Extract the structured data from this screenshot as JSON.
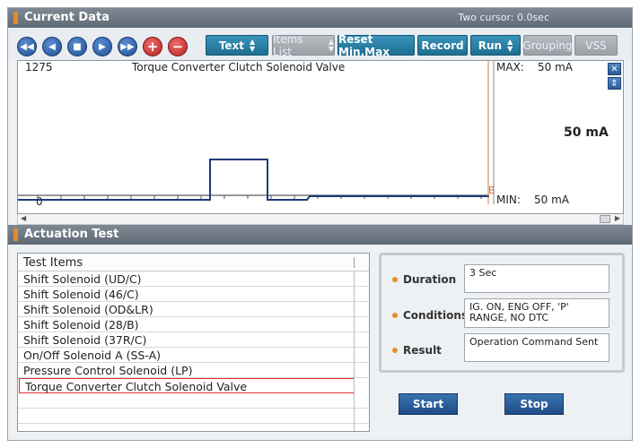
{
  "current_data": {
    "title": "Current Data",
    "cursor_text": "Two cursor: 0.0sec"
  },
  "toolbar": {
    "nav_icons": [
      "rewind-icon",
      "previous-icon",
      "stop-icon",
      "play-icon",
      "fast-forward-icon",
      "zoom-in-icon",
      "zoom-out-icon"
    ],
    "text_label": "Text",
    "items_list_label": "Items List",
    "reset_label": "Reset Min.Max",
    "record_label": "Record",
    "run_label": "Run",
    "grouping_label": "Grouping",
    "vss_label": "VSS"
  },
  "graph": {
    "id_label": "1275",
    "signal_name": "Torque Converter Clutch Solenoid Valve",
    "y_top": "",
    "y_bottom": "0",
    "max_label": "MAX:",
    "max_value": "50 mA",
    "min_label": "MIN:",
    "min_value": "50 mA",
    "current_value": "50 mA",
    "cursor_b": "B"
  },
  "actuation": {
    "title": "Actuation Test",
    "list_header": "Test Items",
    "items": [
      "Shift Solenoid (UD/C)",
      "Shift Solenoid (46/C)",
      "Shift Solenoid (OD&LR)",
      "Shift Solenoid (28/B)",
      "Shift Solenoid (37R/C)",
      "On/Off Solenoid A (SS-A)",
      "Pressure Control Solenoid (LP)",
      "Torque Converter Clutch Solenoid Valve"
    ],
    "selected_index": 7,
    "duration_label": "Duration",
    "duration_value": "3 Sec",
    "conditions_label": "Conditions",
    "conditions_value": "IG. ON, ENG OFF, 'P' RANGE, NO DTC",
    "result_label": "Result",
    "result_value": "Operation Command Sent",
    "start_label": "Start",
    "stop_label": "Stop"
  },
  "colors": {
    "accent": "#1d6f93",
    "header": "#6b7680",
    "selection_border": "#dd3333",
    "grip": "#e58a2a"
  }
}
